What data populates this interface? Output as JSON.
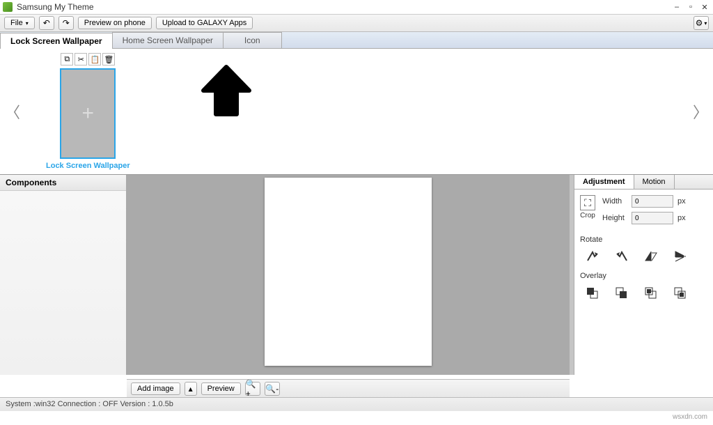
{
  "window": {
    "title": "Samsung My Theme"
  },
  "menu": {
    "file": "File"
  },
  "toolbar": {
    "preview_phone": "Preview on phone",
    "upload_galaxy": "Upload to GALAXY Apps"
  },
  "main_tabs": {
    "lock": "Lock Screen Wallpaper",
    "home": "Home Screen Wallpaper",
    "icon": "Icon"
  },
  "thumb": {
    "label": "Lock Screen Wallpaper"
  },
  "panels": {
    "components": "Components"
  },
  "props": {
    "tabs": {
      "adjustment": "Adjustment",
      "motion": "Motion"
    },
    "crop": "Crop",
    "width_label": "Width",
    "height_label": "Height",
    "width_value": "0",
    "height_value": "0",
    "unit": "px",
    "rotate": "Rotate",
    "overlay": "Overlay"
  },
  "bottom": {
    "add_image": "Add image",
    "preview": "Preview"
  },
  "status": "System :win32 Connection : OFF Version : 1.0.5b",
  "footer": "wsxdn.com"
}
